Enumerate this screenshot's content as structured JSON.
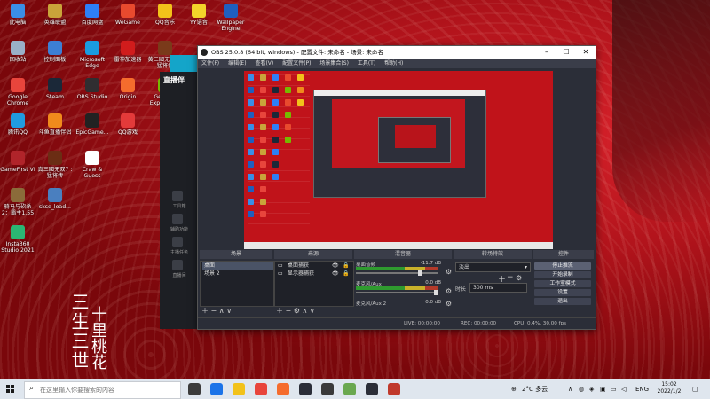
{
  "desktop": {
    "icons": [
      {
        "label": "此电脑",
        "color": "#3a8ee6"
      },
      {
        "label": "英雄联盟",
        "color": "#c9a43a"
      },
      {
        "label": "百度网盘",
        "color": "#2e7ff7"
      },
      {
        "label": "WeGame",
        "color": "#e84a2e"
      },
      {
        "label": "QQ音乐",
        "color": "#f2c21a"
      },
      {
        "label": "YY语音",
        "color": "#f3d42a"
      },
      {
        "label": "Wallpaper Engine",
        "color": "#1f5fbf"
      },
      {
        "label": "回收站",
        "color": "#9ab0c8"
      },
      {
        "label": "控制面板",
        "color": "#3d7fd4"
      },
      {
        "label": "Microsoft Edge",
        "color": "#1a9be0"
      },
      {
        "label": "雷神加速器",
        "color": "#d11c1c"
      },
      {
        "label": "黄三國无双7 : 猛将传",
        "color": "#7a3a1a"
      },
      {
        "label": "Google Chrome",
        "color": "#e8453c"
      },
      {
        "label": "Steam",
        "color": "#1b2838"
      },
      {
        "label": "OBS Studio",
        "color": "#302e31"
      },
      {
        "label": "Origin",
        "color": "#f56c2d"
      },
      {
        "label": "GeForce Experience",
        "color": "#76b900"
      },
      {
        "label": "腾讯QQ",
        "color": "#1f9be0"
      },
      {
        "label": "斗鱼直播伴侣",
        "color": "#f08a1c"
      },
      {
        "label": "EpicGame...",
        "color": "#222222"
      },
      {
        "label": "QQ游戏",
        "color": "#e33a3a"
      },
      {
        "label": "GameFirst VI",
        "color": "#b0242a"
      },
      {
        "label": "真三國无双7 : 猛将传",
        "color": "#6b2d14"
      },
      {
        "label": "Craw & Guess",
        "color": "#ffffff"
      },
      {
        "label": "骑马与砍杀2：霸主1.55",
        "color": "#8b6b3a"
      },
      {
        "label": "skse_load...",
        "color": "#4a7fbf"
      },
      {
        "label": "Insta360 Studio 2021",
        "color": "#2bb673"
      }
    ]
  },
  "wallpaper_text": {
    "line1": "三生三世",
    "line2": "十里桃花"
  },
  "stream_app": {
    "logo": "直播伴",
    "items": [
      "工具箱",
      "辅助功能",
      "主播任务",
      "直播间"
    ]
  },
  "obs": {
    "title": "OBS 25.0.8 (64 bit, windows) - 配置文件: 未命名 - 场景: 未命名",
    "menu": [
      "文件(F)",
      "编辑(E)",
      "查看(V)",
      "配置文件(P)",
      "场景集合(S)",
      "工具(T)",
      "帮助(H)"
    ],
    "docks": {
      "scenes": "场景",
      "sources": "来源",
      "mixer": "混音器",
      "transitions": "转场特效",
      "controls": "控件"
    },
    "scenes": [
      "桌面",
      "场景 2"
    ],
    "sources": [
      "桌面捕获",
      "显示器捕获"
    ],
    "mixer": [
      {
        "name": "桌面音频",
        "db": "-11.7 dB"
      },
      {
        "name": "麦克风/Aux",
        "db": "0.0 dB"
      },
      {
        "name": "麦克风/Aux 2",
        "db": "0.0 dB"
      }
    ],
    "transitions": {
      "type": "淡出",
      "duration_label": "时长",
      "duration": "300 ms"
    },
    "controls": [
      "停止推流",
      "开始录制",
      "工作室模式",
      "设置",
      "退出"
    ],
    "status": {
      "live": "LIVE: 00:00:00",
      "rec": "REC: 00:00:00",
      "cpu": "CPU: 0.4%, 30.00 fps"
    }
  },
  "taskbar": {
    "search_placeholder": "在这里输入你要搜索的内容",
    "weather": "2°C 多云",
    "ime": "ENG",
    "time": "15:02",
    "date": "2022/1/2",
    "apps": [
      "#3b3b3b",
      "#1a73e8",
      "#f2c21a",
      "#e8453c",
      "#f56c2d",
      "#2b2e38",
      "#3a3a3a",
      "#6aa84f",
      "#2b2e38",
      "#c0392b"
    ]
  }
}
